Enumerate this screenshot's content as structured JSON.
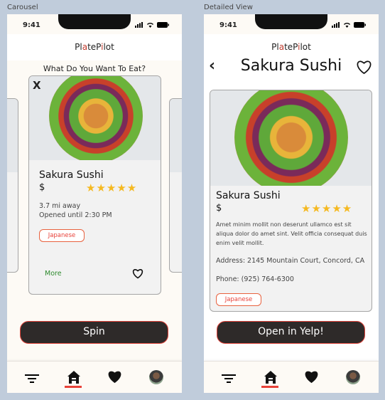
{
  "frames": {
    "left_label": "Carousel",
    "right_label": "Detailed View"
  },
  "status": {
    "time": "9:41"
  },
  "app": {
    "logo_parts": [
      "Pl",
      "a",
      "teP",
      "i",
      "lot"
    ]
  },
  "carousel": {
    "prompt": "What Do You Want To Eat?",
    "close_label": "X",
    "card": {
      "name": "Sakura Sushi",
      "price": "$",
      "stars": "★★★★★",
      "rating": 5,
      "distance": "3.7 mi away",
      "hours": "Opened until 2:30 PM",
      "tag": "Japanese",
      "more_label": "More"
    },
    "spin_label": "Spin"
  },
  "detail": {
    "back_label": "‹",
    "title": "Sakura Sushi",
    "card": {
      "name": "Sakura Sushi",
      "price": "$",
      "stars": "★★★★★",
      "rating": 5,
      "description": "Amet minim mollit non deserunt ullamco est sit aliqua dolor do amet sint. Velit officia consequat duis enim velit mollit.",
      "address": "Address: 2145 Mountain Court, Concord, CA",
      "phone": "Phone: (925) 764-6300",
      "tag": "Japanese"
    },
    "yelp_label": "Open in Yelp!"
  },
  "colors": {
    "accent": "#e8423a",
    "button": "#2e2a29",
    "star": "#f5b921"
  }
}
